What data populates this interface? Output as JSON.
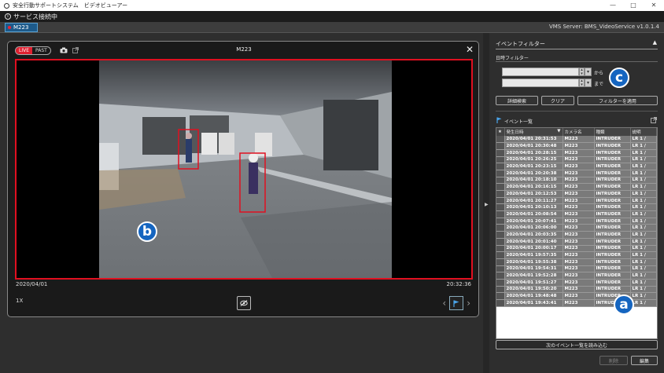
{
  "window": {
    "title": "安全行動サポートシステム　ビデオビューアー",
    "min": "—",
    "max": "□",
    "close": "✕"
  },
  "status": {
    "text": "サービス接続中"
  },
  "tab": {
    "label": "M223"
  },
  "server": {
    "text": "VMS Server: BMS_VideoService v1.0.1.4"
  },
  "viewer": {
    "live_label": "LIVE",
    "past_label": "PAST",
    "camera_title": "M223",
    "date": "2020/04/01",
    "time": "20:32:36",
    "speed": "1X",
    "close": "✕"
  },
  "filter": {
    "header": "イベントフィルター",
    "date_filter": "日時フィルター",
    "from": "から",
    "to": "まで",
    "advanced": "詳細検索",
    "clear": "クリア",
    "apply": "フィルターを適用"
  },
  "events": {
    "header": "イベント一覧",
    "columns": [
      "★",
      "発生日時",
      "カメラ名",
      "種類",
      "説明"
    ],
    "rows": [
      [
        "2020/04/01 20:31:53",
        "M223",
        "INTRUDER",
        "LR 1 /"
      ],
      [
        "2020/04/01 20:30:48",
        "M223",
        "INTRUDER",
        "LR 1 /"
      ],
      [
        "2020/04/01 20:28:15",
        "M223",
        "INTRUDER",
        "LR 1 /"
      ],
      [
        "2020/04/01 20:26:25",
        "M223",
        "INTRUDER",
        "LR 1 /"
      ],
      [
        "2020/04/01 20:23:15",
        "M223",
        "INTRUDER",
        "LR 1 /"
      ],
      [
        "2020/04/01 20:20:38",
        "M223",
        "INTRUDER",
        "LR 1 /"
      ],
      [
        "2020/04/01 20:18:10",
        "M223",
        "INTRUDER",
        "LR 1 /"
      ],
      [
        "2020/04/01 20:16:15",
        "M223",
        "INTRUDER",
        "LR 1 /"
      ],
      [
        "2020/04/01 20:12:53",
        "M223",
        "INTRUDER",
        "LR 1 /"
      ],
      [
        "2020/04/01 20:11:27",
        "M223",
        "INTRUDER",
        "LR 1 /"
      ],
      [
        "2020/04/01 20:10:13",
        "M223",
        "INTRUDER",
        "LR 1 /"
      ],
      [
        "2020/04/01 20:08:54",
        "M223",
        "INTRUDER",
        "LR 1 /"
      ],
      [
        "2020/04/01 20:07:41",
        "M223",
        "INTRUDER",
        "LR 1 /"
      ],
      [
        "2020/04/01 20:06:00",
        "M223",
        "INTRUDER",
        "LR 1 /"
      ],
      [
        "2020/04/01 20:03:35",
        "M223",
        "INTRUDER",
        "LR 1 /"
      ],
      [
        "2020/04/01 20:01:40",
        "M223",
        "INTRUDER",
        "LR 1 /"
      ],
      [
        "2020/04/01 20:00:17",
        "M223",
        "INTRUDER",
        "LR 1 /"
      ],
      [
        "2020/04/01 19:57:35",
        "M223",
        "INTRUDER",
        "LR 1 /"
      ],
      [
        "2020/04/01 19:55:38",
        "M223",
        "INTRUDER",
        "LR 1 /"
      ],
      [
        "2020/04/01 19:54:31",
        "M223",
        "INTRUDER",
        "LR 1 /"
      ],
      [
        "2020/04/01 19:52:28",
        "M223",
        "INTRUDER",
        "LR 1 /"
      ],
      [
        "2020/04/01 19:51:27",
        "M223",
        "INTRUDER",
        "LR 1 /"
      ],
      [
        "2020/04/01 19:50:20",
        "M223",
        "INTRUDER",
        "LR 1 /"
      ],
      [
        "2020/04/01 19:48:48",
        "M223",
        "INTRUDER",
        "LR 1 /"
      ],
      [
        "2020/04/01 19:43:41",
        "M223",
        "INTRUDER",
        "LR 1 /"
      ]
    ],
    "load_next": "次のイベント一覧を読み込む",
    "delete": "削除",
    "edit": "編集"
  },
  "badges": {
    "a": "a",
    "b": "b",
    "c": "c"
  },
  "colors": {
    "accent": "#1565c0",
    "alert": "#e01020",
    "live": "#e02030"
  }
}
